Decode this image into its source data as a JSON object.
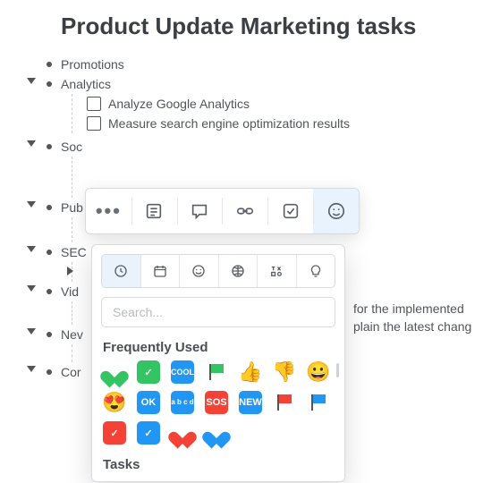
{
  "title": "Product Update Marketing tasks",
  "tree": {
    "promotions": "Promotions",
    "analytics": "Analytics",
    "analytics_children": {
      "analyze": "Analyze Google Analytics",
      "measure": "Measure search engine optimization results"
    },
    "social": "Soc",
    "publishing": "Pub",
    "seo": "SEC",
    "video": "Vid",
    "newsletters": "Nev",
    "content": "Cor"
  },
  "bg_text": {
    "line1": "for the implemented",
    "line2": "plain the latest chang"
  },
  "toolbar": {
    "more_label": "•••"
  },
  "picker": {
    "search_placeholder": "Search...",
    "section_frequent": "Frequently Used",
    "section_tasks": "Tasks",
    "icons": {
      "cool": "COOL",
      "ok": "OK",
      "abcd": "a b c d",
      "sos": "SOS",
      "new": "NEW",
      "check": "✓",
      "thumbs_up": "👍",
      "thumbs_down": "👎",
      "grin": "😀",
      "heart_eyes": "😍"
    }
  }
}
